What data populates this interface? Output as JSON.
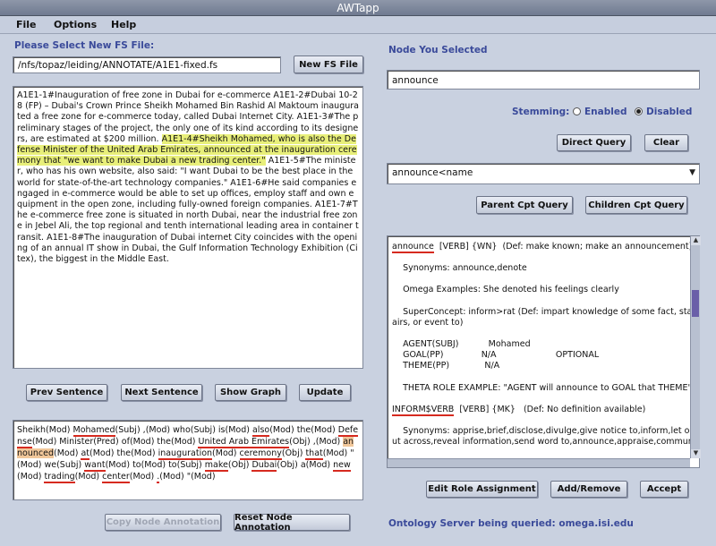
{
  "window": {
    "title": "AWTapp"
  },
  "menu": {
    "items": [
      "File",
      "Options",
      "Help"
    ]
  },
  "left": {
    "select_label": "Please Select New FS File:",
    "file_path": "/nfs/topaz/leiding/ANNOTATE/A1E1-fixed.fs",
    "new_fs_button": "New FS File",
    "document_text": {
      "before": "A1E1-1#Inauguration of free zone in Dubai for e-commerce    A1E1-2#Dubai 10-28 (FP) – Dubai's Crown Prince Sheikh Mohamed Bin Rashid Al Maktoum inaugurated a free zone for e-commerce today, called Dubai Internet City.    A1E1-3#The preliminary stages of the project, the only one of its kind according to its designers, are estimated at $200 million.  ",
      "highlight": "A1E1-4#Sheikh Mohamed, who is also the Defense Minister of the United Arab Emirates, announced at the inauguration ceremony that \"we want to make Dubai a new trading center.\"",
      "after": "    A1E1-5#The minister, who has his own website, also said: \"I want Dubai to be the best place in the world for state-of-the-art technology companies.\"    A1E1-6#He said companies engaged in e-commerce would be able to set up offices, employ staff and own equipment in the open zone, including fully-owned foreign companies.    A1E1-7#The e-commerce free zone is situated in north Dubai, near the industrial free zone in Jebel Ali, the top regional and tenth international leading area in container transit.    A1E1-8#The inauguration of Dubai internet City coincides with the opening of an annual IT show in Dubai, the Gulf Information Technology Exhibition (Citex), the biggest in the Middle East."
    },
    "prev_sentence": "Prev Sentence",
    "next_sentence": "Next Sentence",
    "show_graph": "Show Graph",
    "update": "Update",
    "annotation_tokens": [
      {
        "w": "Sheikh(Mod) ",
        "s": ""
      },
      {
        "w": "Mohamed",
        "s": "ul"
      },
      {
        "w": "(Subj) ,(Mod) who(Subj) is(Mod) ",
        "s": ""
      },
      {
        "w": "also",
        "s": "ul"
      },
      {
        "w": "(Mod) the(Mod) ",
        "s": ""
      },
      {
        "w": "Defense",
        "s": "ul"
      },
      {
        "w": "(Mod) Minister(Pred) of(Mod) the(Mod) ",
        "s": ""
      },
      {
        "w": "United Arab Emirates",
        "s": "ul"
      },
      {
        "w": "(Obj) ,(Mod) ",
        "s": ""
      },
      {
        "w": "announced",
        "s": "hl2"
      },
      {
        "w": "(Mod) ",
        "s": ""
      },
      {
        "w": "at",
        "s": "ul"
      },
      {
        "w": "(Mod) the(Mod) ",
        "s": ""
      },
      {
        "w": "inauguration",
        "s": "ul"
      },
      {
        "w": "(Mod) ",
        "s": ""
      },
      {
        "w": "ceremony",
        "s": "ul"
      },
      {
        "w": "(Obj) ",
        "s": ""
      },
      {
        "w": "that",
        "s": "ul"
      },
      {
        "w": "(Mod) \"(Mod) we(Subj) ",
        "s": ""
      },
      {
        "w": "want",
        "s": "ul"
      },
      {
        "w": "(Mod) to(Mod) to(Subj) ",
        "s": ""
      },
      {
        "w": "make",
        "s": "ul"
      },
      {
        "w": "(Obj) ",
        "s": ""
      },
      {
        "w": "Dubai",
        "s": "ul"
      },
      {
        "w": "(Obj) a(Mod) ",
        "s": ""
      },
      {
        "w": "new",
        "s": "ul"
      },
      {
        "w": "(Mod) ",
        "s": ""
      },
      {
        "w": "trading",
        "s": "ul"
      },
      {
        "w": "(Mod) ",
        "s": ""
      },
      {
        "w": "center",
        "s": "ul"
      },
      {
        "w": "(Mod) ",
        "s": ""
      },
      {
        "w": ".",
        "s": "ul"
      },
      {
        "w": "(Mod) \"(Mod)",
        "s": ""
      }
    ],
    "copy_annotation": "Copy Node Annotation",
    "reset_annotation": "Reset Node Annotation"
  },
  "right": {
    "node_label": "Node You Selected",
    "node_value": "announce",
    "stemming_label": "Stemming:",
    "stemming_enabled": "Enabled",
    "stemming_disabled": "Disabled",
    "stemming_selected": "Disabled",
    "direct_query": "Direct Query",
    "clear": "Clear",
    "concept_select": "announce<name",
    "parent_query": "Parent Cpt Query",
    "children_query": "Children Cpt Query",
    "senses": [
      {
        "head": "announce",
        "rest": "  [VERB] {WN}  (Def: make known; make an announcement)",
        "gap": false
      },
      {
        "text": "Synonyms: announce,denote",
        "indent": true
      },
      {
        "text": "Omega Examples: She denoted his feelings clearly",
        "indent": true
      },
      {
        "text": "SuperConcept: inform>rat (Def: impart knowledge of some fact, state or aff",
        "indent": true
      },
      {
        "text": "airs, or event to)",
        "indent": false
      },
      {
        "text": "AGENT(SUBJ)           Mohamed",
        "indent": true
      },
      {
        "text": "GOAL(PP)              N/A                      OPTIONAL",
        "indent": true
      },
      {
        "text": "THEME(PP)             N/A",
        "indent": true
      },
      {
        "text": "THETA ROLE EXAMPLE: \"AGENT will announce to GOAL that THEME\"",
        "indent": true
      },
      {
        "head": "INFORM$VERB",
        "rest": "  [VERB] {MK}   (Def: No definition available)",
        "gap": false
      },
      {
        "text": "Synonyms: apprise,brief,disclose,divulge,give notice to,inform,let on,notify,p",
        "indent": true
      },
      {
        "text": "ut across,reveal information,send word to,announce,appraise,communicate,ma",
        "indent": false
      }
    ],
    "edit_role": "Edit Role Assignment",
    "add_remove": "Add/Remove",
    "accept": "Accept",
    "server_label": "Ontology Server being queried: omega.isi.edu"
  }
}
